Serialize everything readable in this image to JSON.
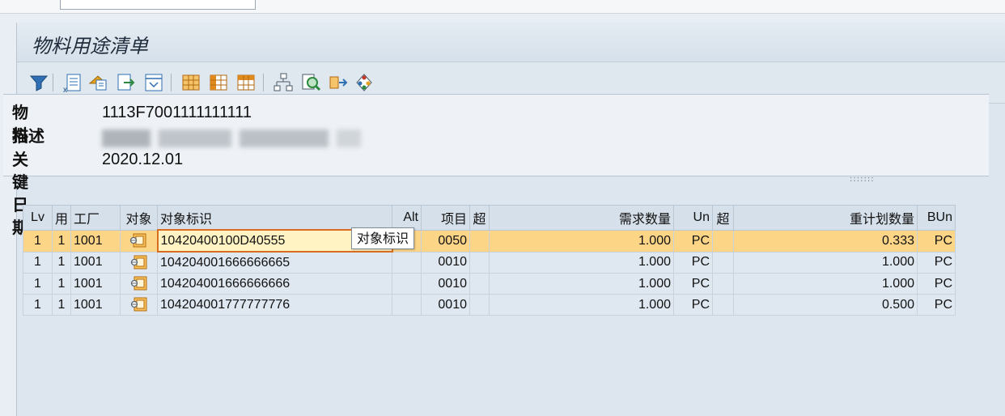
{
  "window": {
    "title": "物料用途清单"
  },
  "toolbar": {
    "buttons": [
      {
        "name": "filter-icon",
        "color": "#2f6fb3"
      },
      {
        "name": "subtotal-icon",
        "color": "#2f6fb3"
      },
      {
        "name": "transfer-icon",
        "color": "#e6a21a"
      },
      {
        "name": "export-icon",
        "color": "#2c8a3f"
      },
      {
        "name": "layout-icon",
        "color": "#2f6fb3"
      },
      {
        "name": "grid-icon",
        "color": "#e08a1e"
      },
      {
        "name": "columns-icon",
        "color": "#e08a1e"
      },
      {
        "name": "rows-icon",
        "color": "#e08a1e"
      },
      {
        "name": "hierarchy-icon",
        "color": "#4c5a68"
      },
      {
        "name": "where-used-search-icon",
        "color": "#2c8a3f"
      },
      {
        "name": "explode-icon",
        "color": "#e6a21a"
      },
      {
        "name": "graphic-icon",
        "color": "#c2372a"
      }
    ]
  },
  "header": {
    "material_label": "物料",
    "material_value": "1113F7001111111111",
    "description_label": "描述",
    "description_value": "",
    "keydate_label": "关键日期",
    "keydate_value": "2020.12.01"
  },
  "table": {
    "columns": [
      "Lv",
      "用",
      "工厂",
      "对象",
      "对象标识",
      "Alt",
      "项目",
      "超",
      "需求数量",
      "Un",
      "超",
      "重计划数量",
      "BUn"
    ],
    "rows": [
      {
        "lv": "1",
        "use": "1",
        "plant": "1001",
        "object_icon": "bom-object-icon",
        "object_id": "10420400100D40555",
        "alt": "",
        "item": "0050",
        "over1": "",
        "qty": "1.000",
        "un": "PC",
        "over2": "",
        "plan_qty": "0.333",
        "bun": "PC",
        "selected": true
      },
      {
        "lv": "1",
        "use": "1",
        "plant": "1001",
        "object_icon": "bom-object-icon",
        "object_id": "104204001666666665",
        "alt": "",
        "item": "0010",
        "over1": "",
        "qty": "1.000",
        "un": "PC",
        "over2": "",
        "plan_qty": "1.000",
        "bun": "PC",
        "selected": false
      },
      {
        "lv": "1",
        "use": "1",
        "plant": "1001",
        "object_icon": "bom-object-icon",
        "object_id": "104204001666666666",
        "alt": "",
        "item": "0010",
        "over1": "",
        "qty": "1.000",
        "un": "PC",
        "over2": "",
        "plan_qty": "1.000",
        "bun": "PC",
        "selected": false
      },
      {
        "lv": "1",
        "use": "1",
        "plant": "1001",
        "object_icon": "bom-object-icon",
        "object_id": "104204001777777776",
        "alt": "",
        "item": "0010",
        "over1": "",
        "qty": "1.000",
        "un": "PC",
        "over2": "",
        "plan_qty": "0.500",
        "bun": "PC",
        "selected": false
      }
    ]
  },
  "tooltip": {
    "text": "对象标识"
  },
  "colors": {
    "selected_row": "#fdd586",
    "current_cell_border": "#d86d22",
    "grid_row": "#dfe8f1"
  }
}
